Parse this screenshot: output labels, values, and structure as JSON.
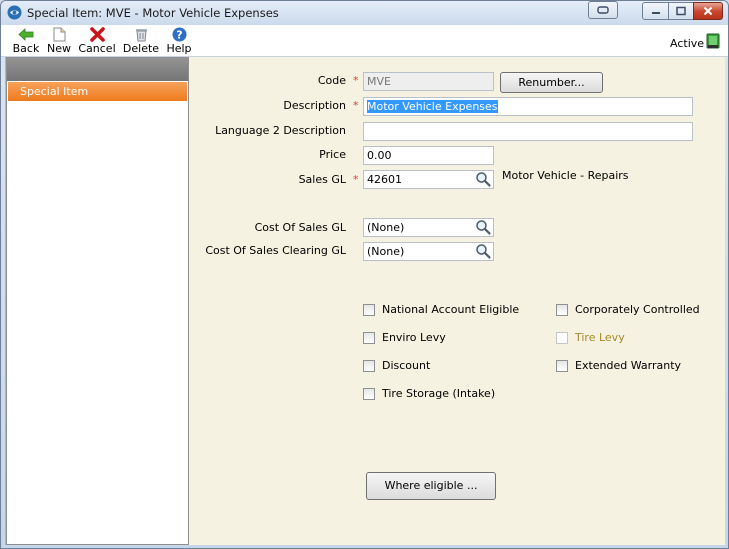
{
  "window": {
    "title": "Special Item: MVE - Motor Vehicle Expenses",
    "icons": [
      "app-icon",
      "restore-icon",
      "minimize-icon",
      "maximize-icon",
      "close-icon"
    ]
  },
  "toolbar": {
    "back": "Back",
    "new": "New",
    "cancel": "Cancel",
    "delete": "Delete",
    "help": "Help",
    "active_label": "Active"
  },
  "sidebar": {
    "items": [
      {
        "label": "Special Item"
      }
    ]
  },
  "form": {
    "code": {
      "label": "Code",
      "value": "MVE",
      "required": "*"
    },
    "renumber_button": "Renumber...",
    "description": {
      "label": "Description",
      "value": "Motor Vehicle Expenses",
      "required": "*"
    },
    "language2": {
      "label": "Language 2 Description",
      "value": ""
    },
    "price": {
      "label": "Price",
      "value": "0.00"
    },
    "sales_gl": {
      "label": "Sales GL",
      "value": "42601",
      "required": "*",
      "gl_description": "Motor Vehicle - Repairs"
    },
    "cost_of_sales_gl": {
      "label": "Cost Of Sales GL",
      "value": "(None)"
    },
    "cost_of_sales_clearing_gl": {
      "label": "Cost Of Sales Clearing GL",
      "value": "(None)"
    }
  },
  "checkboxes": {
    "national_account": {
      "label": "National Account Eligible",
      "checked": false
    },
    "corporately_controlled": {
      "label": "Corporately Controlled",
      "checked": false
    },
    "enviro_levy": {
      "label": "Enviro Levy",
      "checked": false
    },
    "tire_levy": {
      "label": "Tire Levy",
      "checked": false,
      "enabled": false
    },
    "discount": {
      "label": "Discount",
      "checked": false
    },
    "extended_warranty": {
      "label": "Extended Warranty",
      "checked": false
    },
    "tire_storage": {
      "label": "Tire Storage (Intake)",
      "checked": false
    }
  },
  "where_eligible_button": "Where eligible ...",
  "colors": {
    "accent_orange": "#ee7a1d",
    "required": "#e33b2e",
    "panel_bg": "#f5f2e1",
    "selection": "#3399ff",
    "disabled_text": "#a38a2c"
  }
}
